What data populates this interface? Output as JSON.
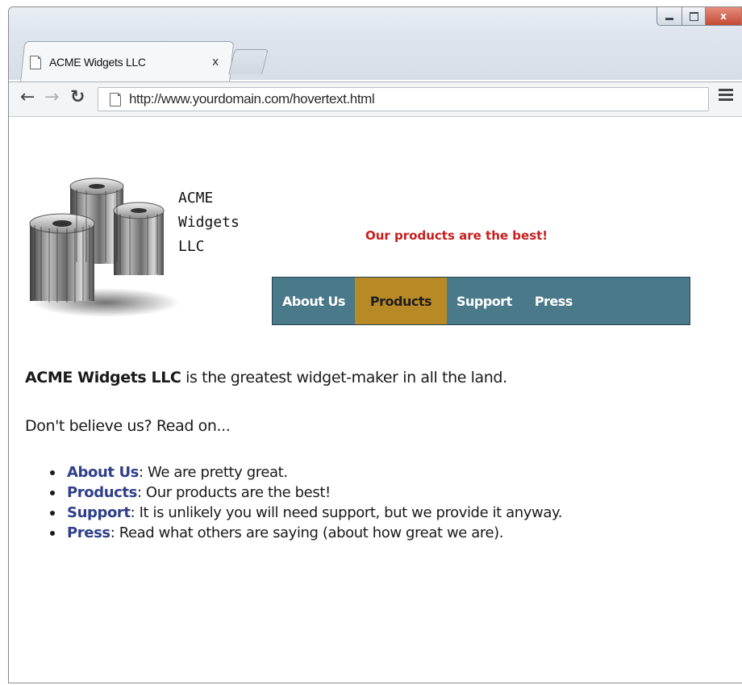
{
  "browser": {
    "tab_title": "ACME Widgets LLC",
    "tab_close": "x",
    "url": "http://www.yourdomain.com/hovertext.html",
    "window_controls": {
      "minimize_icon": "minimize-icon",
      "maximize_icon": "maximize-icon",
      "close_label": "x"
    }
  },
  "page": {
    "company_name": "ACME\nWidgets\nLLC",
    "tagline": "Our products are the best!",
    "nav": [
      {
        "label": "About Us",
        "active": false
      },
      {
        "label": "Products",
        "active": true
      },
      {
        "label": "Support",
        "active": false
      },
      {
        "label": "Press",
        "active": false
      }
    ],
    "intro_bold": "ACME Widgets LLC",
    "intro_rest": " is the greatest widget-maker in all the land.",
    "read_on": "Don't believe us? Read on...",
    "features": [
      {
        "term": "About Us",
        "desc": ": We are pretty great."
      },
      {
        "term": "Products",
        "desc": ": Our products are the best!"
      },
      {
        "term": "Support",
        "desc": ": It is unlikely you will need support, but we provide it anyway."
      },
      {
        "term": "Press",
        "desc": ": Read what others are saying (about how great we are)."
      }
    ]
  },
  "colors": {
    "nav_background": "#4a7a8a",
    "nav_active": "#b88a26",
    "tagline": "#c81e1e",
    "link_term": "#2f3f8a"
  }
}
